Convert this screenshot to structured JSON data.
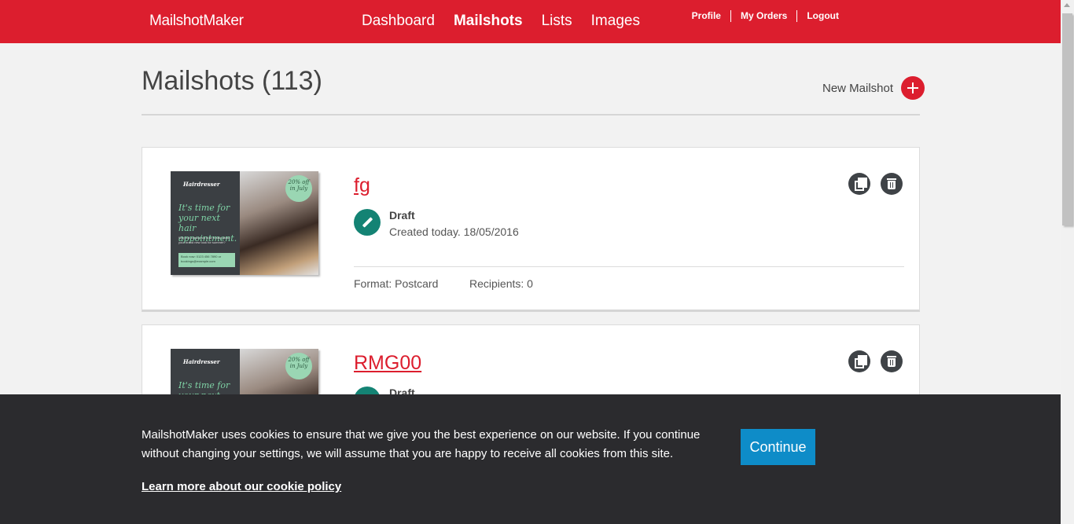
{
  "header": {
    "brand": "MailshotMaker",
    "nav": [
      "Dashboard",
      "Mailshots",
      "Lists",
      "Images"
    ],
    "active_nav": "Mailshots",
    "user_links": [
      "Profile",
      "My Orders",
      "Logout"
    ]
  },
  "page": {
    "title": "Mailshots (113)",
    "new_button_label": "New Mailshot"
  },
  "mailshots": [
    {
      "name": "fg",
      "status": "Draft",
      "created": "Created today. 18/05/2016",
      "format": "Format: Postcard",
      "recipients": "Recipients: 0",
      "thumbnail": {
        "heading": "Hairdresser",
        "tagline": "It's time for your next hair appointment.",
        "small_text": "Why not contact us now to talk about your brand new look for summer?",
        "contact": "Book now: 0123 456 7890 or bookings@example.com",
        "badge": "20% off in July"
      }
    },
    {
      "name": "RMG00",
      "status": "Draft",
      "thumbnail": {
        "heading": "Hairdresser",
        "tagline": "It's time for your next hair",
        "badge": "20% off in July"
      }
    }
  ],
  "cookie_banner": {
    "message": "MailshotMaker uses cookies to ensure that we give you the best experience on our website. If you continue without changing your settings, we will assume that you are happy to receive all cookies from this site.",
    "link": "Learn more about our cookie policy",
    "button": "Continue"
  },
  "colors": {
    "brand_red": "#dc1e2e",
    "draft_green": "#148374",
    "cookie_bg": "#2b2b2e",
    "continue_blue": "#0e8cc8"
  }
}
